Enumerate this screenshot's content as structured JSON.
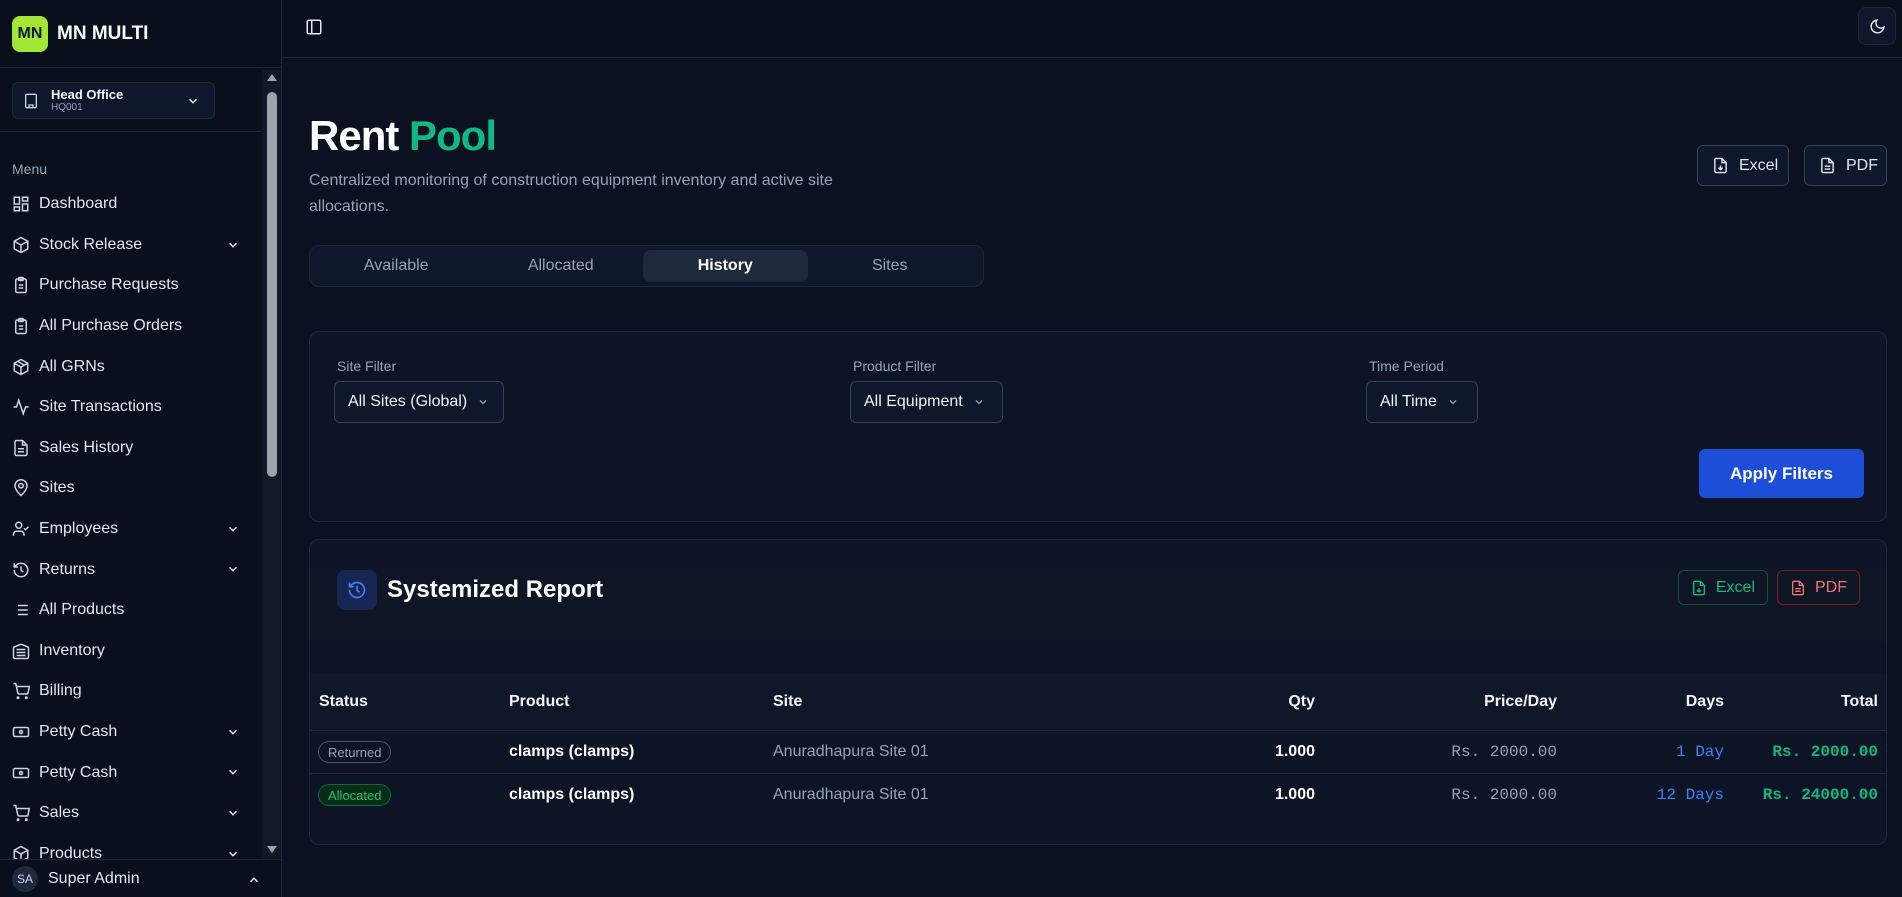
{
  "app": {
    "logo_initials": "MN",
    "name": "MN MULTI"
  },
  "branch": {
    "name": "Head Office",
    "code": "HQ001"
  },
  "sidebar": {
    "menu_label": "Menu",
    "items": [
      {
        "label": "Dashboard",
        "icon": "dashboard-icon",
        "expandable": false
      },
      {
        "label": "Stock Release",
        "icon": "box-icon",
        "expandable": true
      },
      {
        "label": "Purchase Requests",
        "icon": "clipboard-icon",
        "expandable": false
      },
      {
        "label": "All Purchase Orders",
        "icon": "clipboard-icon",
        "expandable": false
      },
      {
        "label": "All GRNs",
        "icon": "package-icon",
        "expandable": false
      },
      {
        "label": "Site Transactions",
        "icon": "activity-icon",
        "expandable": false
      },
      {
        "label": "Sales History",
        "icon": "document-icon",
        "expandable": false
      },
      {
        "label": "Sites",
        "icon": "map-pin-icon",
        "expandable": false
      },
      {
        "label": "Employees",
        "icon": "user-check-icon",
        "expandable": true
      },
      {
        "label": "Returns",
        "icon": "history-icon",
        "expandable": true
      },
      {
        "label": "All Products",
        "icon": "list-icon",
        "expandable": false
      },
      {
        "label": "Inventory",
        "icon": "warehouse-icon",
        "expandable": false
      },
      {
        "label": "Billing",
        "icon": "cart-icon",
        "expandable": false
      },
      {
        "label": "Petty Cash",
        "icon": "cash-icon",
        "expandable": true
      },
      {
        "label": "Petty Cash",
        "icon": "cash-icon",
        "expandable": true
      },
      {
        "label": "Sales",
        "icon": "cart-icon",
        "expandable": true
      },
      {
        "label": "Products",
        "icon": "package-icon",
        "expandable": true
      }
    ]
  },
  "user": {
    "initials": "SA",
    "name": "Super Admin"
  },
  "page": {
    "title_part1": "Rent",
    "title_part2": "Pool",
    "subtitle": "Centralized monitoring of construction equipment inventory and active site allocations.",
    "export_excel": "Excel",
    "export_pdf": "PDF"
  },
  "tabs": [
    {
      "label": "Available",
      "active": false
    },
    {
      "label": "Allocated",
      "active": false
    },
    {
      "label": "History",
      "active": true
    },
    {
      "label": "Sites",
      "active": false
    }
  ],
  "filters": {
    "site": {
      "label": "Site Filter",
      "value": "All Sites (Global)"
    },
    "product": {
      "label": "Product Filter",
      "value": "All Equipment"
    },
    "period": {
      "label": "Time Period",
      "value": "All Time"
    },
    "apply_label": "Apply Filters"
  },
  "report": {
    "title": "Systemized Report",
    "excel_label": "Excel",
    "pdf_label": "PDF",
    "columns": [
      "Status",
      "Product",
      "Site",
      "Qty",
      "Price/Day",
      "Days",
      "Total"
    ],
    "rows": [
      {
        "status": "Returned",
        "product": "clamps (clamps)",
        "site": "Anuradhapura Site 01",
        "qty": "1.000",
        "price": "Rs. 2000.00",
        "days": "1 Day",
        "total": "Rs. 2000.00"
      },
      {
        "status": "Allocated",
        "product": "clamps (clamps)",
        "site": "Anuradhapura Site 01",
        "qty": "1.000",
        "price": "Rs. 2000.00",
        "days": "12 Days",
        "total": "Rs. 24000.00"
      }
    ]
  },
  "colors": {
    "accent_green": "#10b981",
    "primary_blue": "#1d4ed8",
    "days_blue": "#3b82f6",
    "danger_red": "#f87171",
    "brand_lime": "#a3e635"
  }
}
